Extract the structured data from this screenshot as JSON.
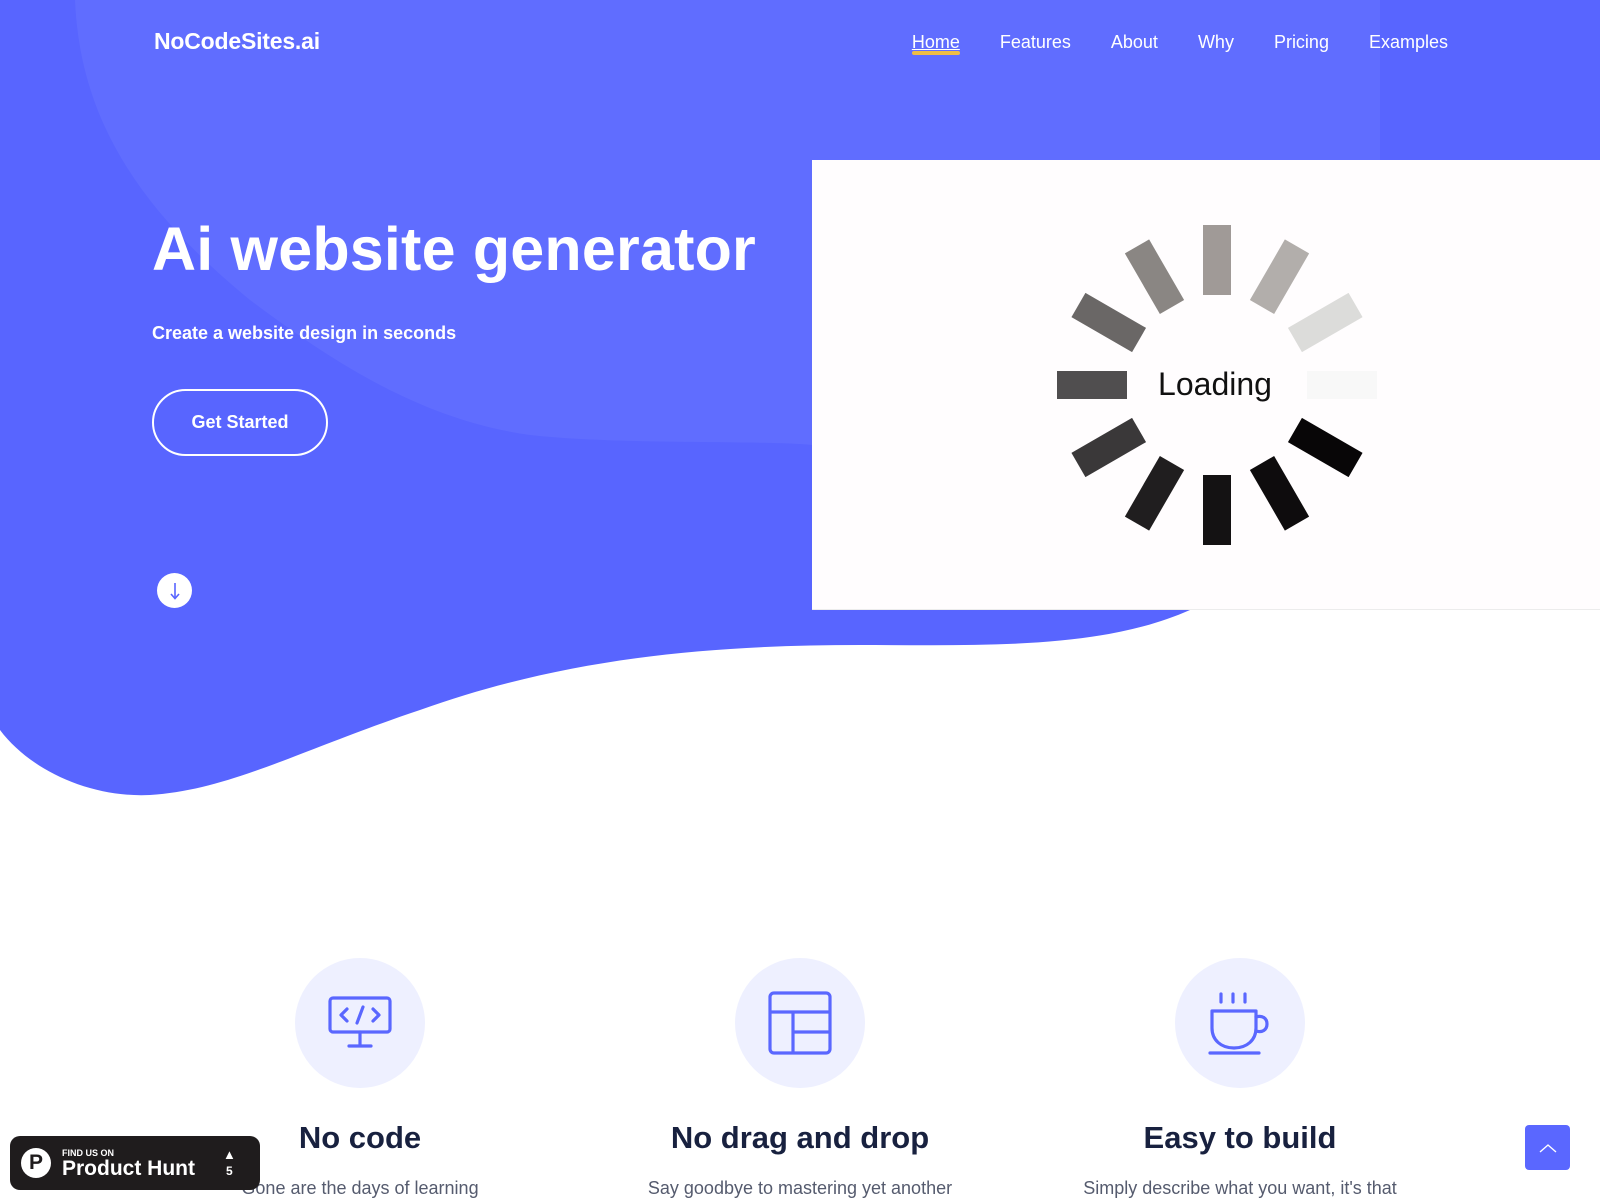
{
  "colors": {
    "brand": "#5865FF",
    "brand_light": "#6470ff",
    "nav_active_underline": "#F5C23C",
    "feature_icon_bg": "#EEF0FF",
    "feature_title": "#18213F",
    "product_hunt_bg": "#1F1C1D"
  },
  "header": {
    "logo": "NoCodeSites.ai",
    "nav": [
      {
        "label": "Home",
        "active": true
      },
      {
        "label": "Features",
        "active": false
      },
      {
        "label": "About",
        "active": false
      },
      {
        "label": "Why",
        "active": false
      },
      {
        "label": "Pricing",
        "active": false
      },
      {
        "label": "Examples",
        "active": false
      }
    ]
  },
  "hero": {
    "title": "Ai website generator",
    "subtitle": "Create a website design in seconds",
    "cta_label": "Get Started",
    "scroll_icon": "arrow-down-icon"
  },
  "preview": {
    "loading_text": "Loading",
    "spinner_icon": "loading-spinner-icon"
  },
  "features": [
    {
      "icon": "code-monitor-icon",
      "title": "No code",
      "desc": "Gone are the days of learning"
    },
    {
      "icon": "layout-icon",
      "title": "No drag and drop",
      "desc": "Say goodbye to mastering yet another"
    },
    {
      "icon": "coffee-cup-icon",
      "title": "Easy to build",
      "desc": "Simply describe what you want, it's that"
    }
  ],
  "product_hunt": {
    "small_text": "FIND US ON",
    "big_text": "Product Hunt",
    "logo_letter": "P",
    "upvote_icon": "▲",
    "upvotes": "5"
  },
  "back_to_top": {
    "icon": "chevron-up-icon"
  }
}
